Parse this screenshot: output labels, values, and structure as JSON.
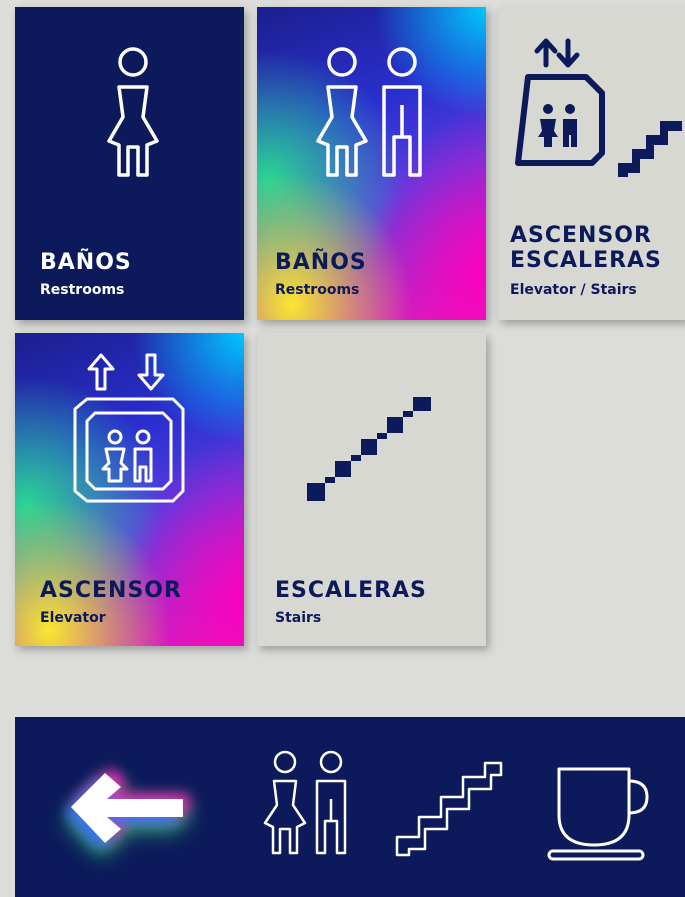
{
  "cards": [
    {
      "title": "BAÑOS",
      "subtitle": "Restrooms",
      "icon": "woman-icon"
    },
    {
      "title": "BAÑOS",
      "subtitle": "Restrooms",
      "icon": "restroom-icon"
    },
    {
      "title_line1": "ASCENSOR",
      "title_line2": "ESCALERAS",
      "subtitle": "Elevator / Stairs",
      "icon": "elevator-stairs-icon"
    },
    {
      "title": "ASCENSOR",
      "subtitle": "Elevator",
      "icon": "elevator-icon"
    },
    {
      "title": "ESCALERAS",
      "subtitle": "Stairs",
      "icon": "stairs-icon"
    }
  ],
  "banner": {
    "icons": [
      "left-arrow-icon",
      "restroom-icon",
      "stairs-icon",
      "coffee-cup-icon"
    ]
  },
  "colors": {
    "navy": "#0c1a5b",
    "light": "#d8d8d3",
    "background": "#dcdcda"
  }
}
